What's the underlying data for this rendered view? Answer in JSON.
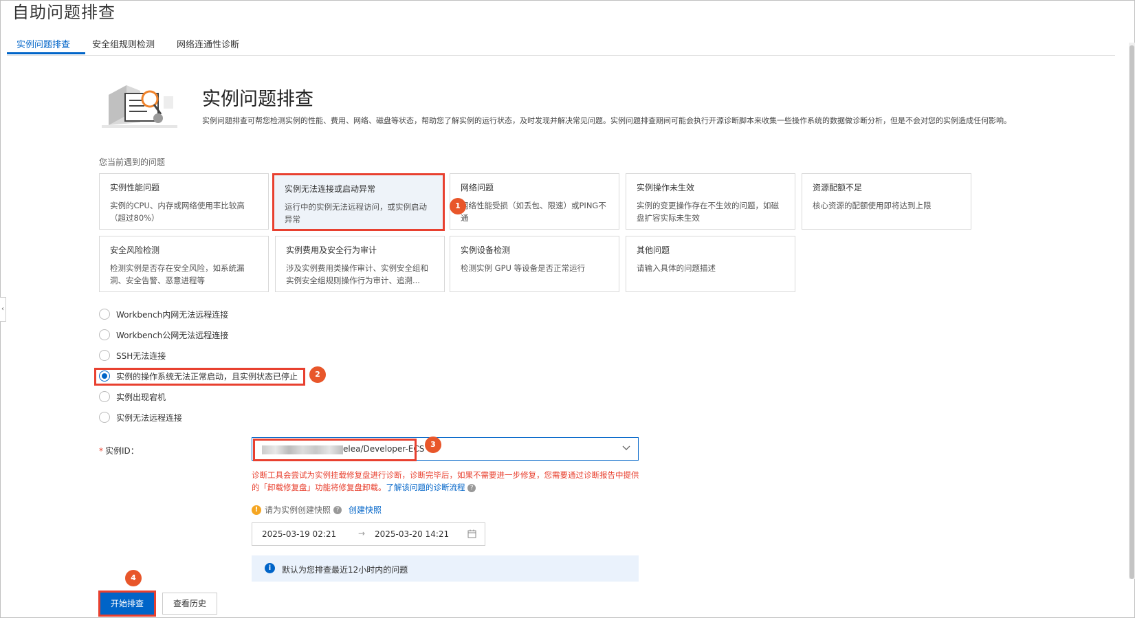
{
  "page": {
    "title": "自助问题排查"
  },
  "tabs": [
    {
      "label": "实例问题排查",
      "active": true
    },
    {
      "label": "安全组规则检测",
      "active": false
    },
    {
      "label": "网络连通性诊断",
      "active": false
    }
  ],
  "hero": {
    "title": "实例问题排查",
    "description": "实例问题排查可帮您检测实例的性能、费用、网络、磁盘等状态，帮助您了解实例的运行状态，及时发现并解决常见问题。实例问题排查期间可能会执行开源诊断脚本来收集一些操作系统的数据做诊断分析，但是不会对您的实例造成任何影响。"
  },
  "issues": {
    "section_label": "您当前遇到的问题",
    "cards": [
      {
        "title": "实例性能问题",
        "desc": "实例的CPU、内存或网络使用率比较高（超过80%）",
        "selected": false
      },
      {
        "title": "实例无法连接或启动异常",
        "desc": "运行中的实例无法远程访问，或实例启动异常",
        "selected": true
      },
      {
        "title": "网络问题",
        "desc": "网络性能受损（如丢包、限速）或PING不通",
        "selected": false
      },
      {
        "title": "实例操作未生效",
        "desc": "实例的变更操作存在不生效的问题，如磁盘扩容实际未生效",
        "selected": false
      },
      {
        "title": "资源配额不足",
        "desc": "核心资源的配额使用即将达到上限",
        "selected": false
      },
      {
        "title": "安全风险检测",
        "desc": "检测实例是否存在安全风险，如系统漏洞、安全告警、恶意进程等",
        "selected": false
      },
      {
        "title": "实例费用及安全行为审计",
        "desc": "涉及实例费用类操作审计、实例安全组和实例安全组规则操作行为审计、追溯...",
        "selected": false
      },
      {
        "title": "实例设备检测",
        "desc": "检测实例 GPU 等设备是否正常运行",
        "selected": false
      },
      {
        "title": "其他问题",
        "desc": "请输入具体的问题描述",
        "selected": false
      }
    ]
  },
  "sub_options": [
    {
      "label": "Workbench内网无法远程连接",
      "checked": false
    },
    {
      "label": "Workbench公网无法远程连接",
      "checked": false
    },
    {
      "label": "SSH无法连接",
      "checked": false
    },
    {
      "label": "实例的操作系统无法正常启动，且实例状态已停止",
      "checked": true
    },
    {
      "label": "实例出现宕机",
      "checked": false
    },
    {
      "label": "实例无法远程连接",
      "checked": false
    }
  ],
  "form": {
    "instance_label": "实例ID：",
    "instance_value": "elea/Developer-ECS",
    "warning_text": "诊断工具会尝试为实例挂载修复盘进行诊断，诊断完毕后，如果不需要进一步修复，您需要通过诊断报告中提供的「卸载修复盘」功能将修复盘卸载。",
    "warning_link": "了解该问题的诊断流程",
    "snapshot_hint": "请为实例创建快照",
    "snapshot_link": "创建快照",
    "date_start": "2025-03-19 02:21",
    "date_arrow": "→",
    "date_end": "2025-03-20 14:21",
    "info_text": "默认为您排查最近12小时内的问题"
  },
  "buttons": {
    "start": "开始排查",
    "history": "查看历史"
  },
  "badges": [
    "1",
    "2",
    "3",
    "4"
  ],
  "icons": {
    "hero": "magnifier-illustration-icon",
    "chevron": "chevron-down-icon",
    "calendar": "calendar-icon",
    "info": "info-icon",
    "warning": "warning-icon",
    "help": "question-icon"
  },
  "colors": {
    "accent": "#0064c8",
    "highlight": "#e8402f",
    "badge": "#e8562a",
    "info_bg": "#eaf2fc"
  }
}
